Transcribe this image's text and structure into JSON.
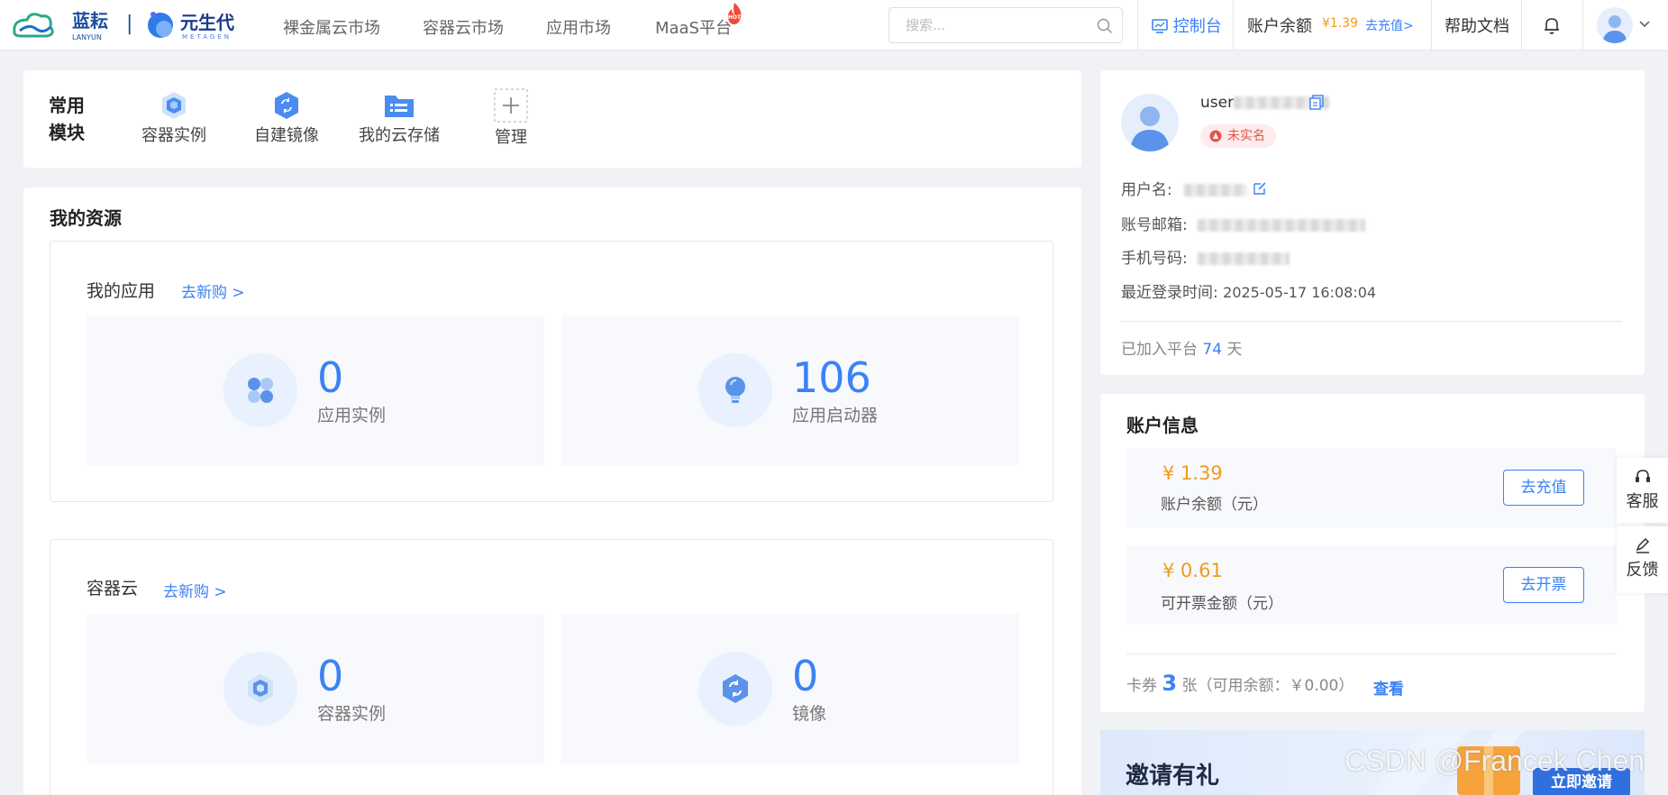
{
  "brand": {
    "logo1_text": "蓝耘",
    "logo1_sub": "LANYUN",
    "logo2_text": "元生代",
    "logo2_sub": "METAGEN"
  },
  "nav": [
    "裸金属云市场",
    "容器云市场",
    "应用市场",
    "MaaS平台"
  ],
  "nav_hot_badge": "HOT",
  "search": {
    "placeholder": "搜索..."
  },
  "header": {
    "console": "控制台",
    "balance_label": "账户余额",
    "balance_value": "¥1.39",
    "recharge_link": "去充值>",
    "help": "帮助文档"
  },
  "modules": {
    "title": "常用模块",
    "items": [
      {
        "label": "容器实例",
        "icon": "container-icon"
      },
      {
        "label": "自建镜像",
        "icon": "image-icon"
      },
      {
        "label": "我的云存储",
        "icon": "storage-icon"
      },
      {
        "label": "管理",
        "icon": "plus-icon"
      }
    ]
  },
  "resources": {
    "title": "我的资源",
    "apps": {
      "title": "我的应用",
      "buy": "去新购 >",
      "stats": [
        {
          "value": "0",
          "label": "应用实例"
        },
        {
          "value": "106",
          "label": "应用启动器"
        }
      ]
    },
    "container": {
      "title": "容器云",
      "buy": "去新购 >",
      "stats": [
        {
          "value": "0",
          "label": "容器实例"
        },
        {
          "value": "0",
          "label": "镜像"
        }
      ]
    }
  },
  "profile": {
    "user_prefix": "user",
    "verify_badge": "未实名",
    "username_label": "用户名:",
    "email_label": "账号邮箱:",
    "phone_label": "手机号码:",
    "last_login_label": "最近登录时间:",
    "last_login_value": "2025-05-17 16:08:04",
    "joined_prefix": "已加入平台",
    "joined_days": "74",
    "joined_suffix": "天"
  },
  "account": {
    "title": "账户信息",
    "balance_amount": "¥ 1.39",
    "balance_label": "账户余额（元）",
    "recharge_button": "去充值",
    "invoice_amount": "¥ 0.61",
    "invoice_label": "可开票金额（元）",
    "invoice_button": "去开票",
    "coupon_prefix": "卡券",
    "coupon_count": "3",
    "coupon_suffix": "张（可用余额：￥0.00）",
    "coupon_view": "查看"
  },
  "float": {
    "service": "客服",
    "feedback": "反馈"
  },
  "invite": {
    "title": "邀请有礼",
    "button": "立即邀请"
  },
  "watermark": "CSDN @Francek Chen",
  "colors": {
    "accent": "#3b82f6",
    "money": "#f29a1d",
    "badge_red": "#e5534b"
  }
}
